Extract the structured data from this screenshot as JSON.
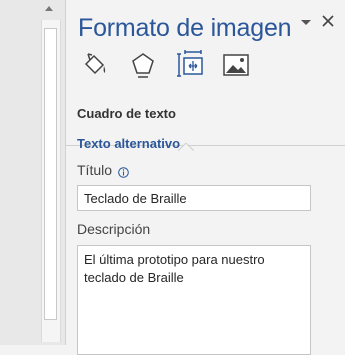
{
  "pane": {
    "title": "Formato de imagen",
    "menu_icon": "chevron-down-icon",
    "close_icon": "close-icon"
  },
  "tabs": [
    {
      "name": "fill-line",
      "icon": "paint-bucket-icon"
    },
    {
      "name": "effects",
      "icon": "pentagon-icon"
    },
    {
      "name": "layout-properties",
      "icon": "size-properties-icon",
      "selected": true
    },
    {
      "name": "picture",
      "icon": "picture-icon"
    }
  ],
  "section": {
    "title": "Cuadro de texto"
  },
  "alt_text": {
    "title": "Texto alternativo",
    "title_label": "Título",
    "title_value": "Teclado de Braille",
    "description_label": "Descripción",
    "description_value": "El última prototipo para nuestro teclado de Braille"
  },
  "colors": {
    "accent": "#2b579a",
    "background": "#f3f3f3"
  }
}
